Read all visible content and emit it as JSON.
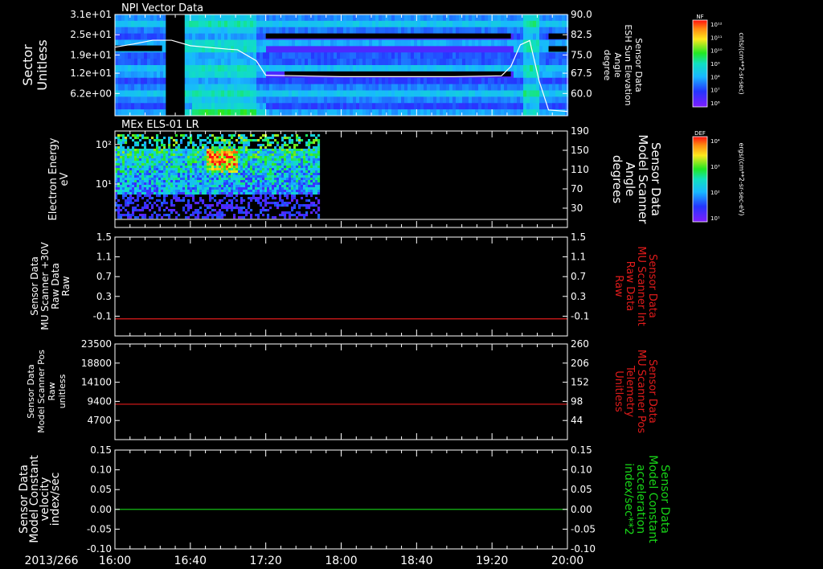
{
  "x_axis": {
    "date_label": "2013/266",
    "tick_labels": [
      "16:00",
      "16:40",
      "17:20",
      "18:00",
      "18:40",
      "19:20",
      "20:00"
    ],
    "minor_ticks_per_major": 4
  },
  "chart_data": [
    {
      "type": "heatmap",
      "title": "NPI Vector Data",
      "ylabel": "Sector",
      "ylabel_sub": "Unitless",
      "y_ticks": [
        "3.1e+01",
        "2.5e+01",
        "1.9e+01",
        "1.2e+01",
        "6.2e+00"
      ],
      "right_axis": {
        "lines": [
          "Sensor Data",
          "ESH Sun Elevation",
          "Angle",
          "degree"
        ],
        "ticks": [
          "90.0",
          "82.5",
          "75.0",
          "67.5",
          "60.0"
        ],
        "ylim": [
          55,
          90
        ]
      },
      "overlay_line": {
        "color": "#ffffff",
        "x": [
          "16:00",
          "16:10",
          "16:20",
          "16:30",
          "16:40",
          "17:00",
          "17:05",
          "17:15",
          "17:20",
          "18:00",
          "19:00",
          "19:25",
          "19:30",
          "19:35",
          "19:40",
          "19:45",
          "19:50",
          "20:00"
        ],
        "y": [
          78.7,
          79.8,
          81.1,
          81.1,
          79.2,
          78.0,
          77.8,
          74.0,
          69.0,
          68.5,
          68.5,
          68.8,
          72.0,
          79.5,
          81.0,
          67.0,
          57.0,
          56.5
        ]
      },
      "colorbar": {
        "label": "NF",
        "units": "cnts/(cm**2-sr-sec)",
        "ticks": [
          "10¹²",
          "10¹¹",
          "10¹⁰",
          "10⁹",
          "10⁸",
          "10⁷",
          "10⁶"
        ]
      }
    },
    {
      "type": "heatmap",
      "title": "MEx ELS-01 LR",
      "ylabel": "Electron Energy",
      "ylabel_sub": "eV",
      "y_ticks": [
        "10²",
        "10¹"
      ],
      "right_axis": {
        "lines": [
          "Sensor Data",
          "Model Scanner",
          "Angle",
          "degrees"
        ],
        "ticks": [
          "190",
          "150",
          "110",
          "70",
          "30"
        ],
        "ylim": [
          10,
          190
        ]
      },
      "data_extent": {
        "start": "16:00",
        "end": "17:48"
      },
      "colorbar": {
        "label": "DEF",
        "units": "ergs/(cm**2-sr-sec-eV)",
        "ticks": [
          "10⁴",
          "10³",
          "10²",
          "10¹"
        ]
      }
    },
    {
      "type": "line",
      "ylabel_lines": [
        "Sensor Data",
        "MU Scanner +30V",
        "Raw Data",
        "Raw"
      ],
      "y_ticks": [
        "1.5",
        "1.1",
        "0.7",
        "0.3",
        "-0.1"
      ],
      "ylim": [
        -0.35,
        1.5
      ],
      "series": [
        {
          "color": "#e11b1b",
          "x": [
            "16:00",
            "20:00"
          ],
          "y": [
            -0.03,
            -0.03
          ]
        }
      ],
      "right_axis": {
        "color": "#e11b1b",
        "lines": [
          "Sensor Data",
          "MU Scanner Int",
          "Raw Data",
          "Raw"
        ],
        "ticks": [
          "1.5",
          "1.1",
          "0.7",
          "0.3",
          "-0.1"
        ]
      }
    },
    {
      "type": "line",
      "ylabel_lines": [
        "Sensor Data",
        "Model Scanner Pos",
        "Raw",
        "unitless"
      ],
      "y_ticks": [
        "23500",
        "18800",
        "14100",
        "9400",
        "4700"
      ],
      "ylim": [
        0,
        23500
      ],
      "series": [
        {
          "color": "#e11b1b",
          "x": [
            "16:00",
            "20:00"
          ],
          "y": [
            8700,
            8700
          ]
        }
      ],
      "right_axis": {
        "color": "#e11b1b",
        "lines": [
          "Sensor Data",
          "MU Scanner Pos",
          "Telemetry",
          "Unitless"
        ],
        "ticks": [
          "260",
          "206",
          "152",
          "98",
          "44"
        ]
      }
    },
    {
      "type": "line",
      "ylabel_lines": [
        "Sensor Data",
        "Model Constant",
        "velocity",
        "index/sec"
      ],
      "y_ticks": [
        "0.15",
        "0.10",
        "0.05",
        "0.00",
        "-0.05",
        "-0.10"
      ],
      "ylim": [
        -0.1,
        0.15
      ],
      "series": [
        {
          "color": "#18d418",
          "x": [
            "16:00",
            "20:00"
          ],
          "y": [
            0.0,
            0.0
          ]
        }
      ],
      "right_axis": {
        "color": "#18d418",
        "lines": [
          "Sensor Data",
          "Model Constant",
          "acceleration",
          "index/sec**2"
        ],
        "ticks": [
          "0.15",
          "0.10",
          "0.05",
          "0.00",
          "-0.05",
          "-0.10"
        ]
      }
    }
  ]
}
